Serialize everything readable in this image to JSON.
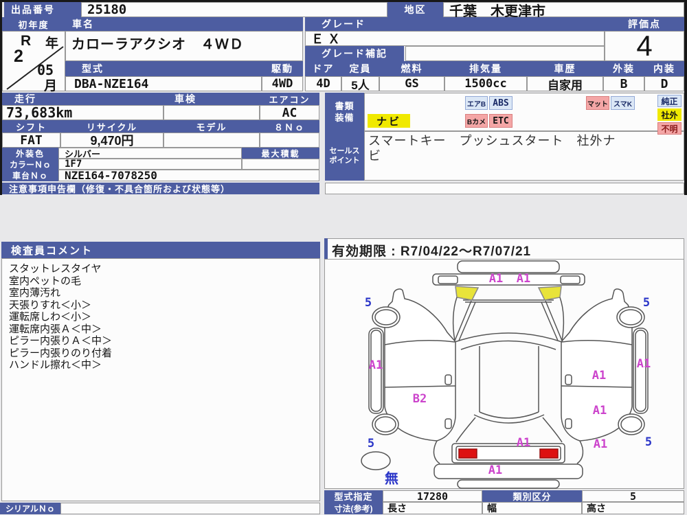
{
  "header": {
    "lot_label": "出品番号",
    "lot_value": "25180",
    "district_label": "地区",
    "district_value": "千葉　木更津市",
    "first_year_label": "初年度",
    "first_year_era": "R",
    "first_year_era_suffix": "年",
    "first_year_value": "2",
    "first_year_month": "05",
    "first_year_month_suffix": "月",
    "car_name_label": "車名",
    "car_name_value": "カローラアクシオ　４ＷＤ",
    "grade_label": "グレード",
    "grade_value": "ＥＸ",
    "grade_note_label": "グレード補記",
    "grade_note_value": "",
    "score_label": "評価点",
    "score_value": "4"
  },
  "specs": {
    "model_label": "型式",
    "model_value": "DBA-NZE164",
    "drive_label": "駆動",
    "drive_value": "4WD",
    "door_label": "ドア",
    "door_value": "4D",
    "capacity_label": "定員",
    "capacity_value": "5人",
    "fuel_label": "燃料",
    "fuel_value": "GS",
    "displacement_label": "排気量",
    "displacement_value": "1500cc",
    "history_label": "車歴",
    "history_value": "自家用",
    "exterior_label": "外装",
    "exterior_value": "B",
    "interior_label": "内装",
    "interior_value": "D"
  },
  "details": {
    "mileage_label": "走行",
    "mileage_value": "73,683km",
    "inspection_label": "車検",
    "inspection_value": "",
    "aircon_label": "エアコン",
    "aircon_value": "AC",
    "shift_label": "シフト",
    "shift_value": "FAT",
    "recycle_label": "リサイクル",
    "recycle_value": "9,470円",
    "model2_label": "モデル",
    "model2_value": "",
    "eight_no_label": "８Ｎｏ",
    "eight_no_value": "",
    "color_label": "外装色",
    "color_value": "シルバー",
    "max_load_label": "最大積載",
    "max_load_value": "",
    "color_no_label": "カラーＮｏ",
    "color_no_value": "1F7",
    "chassis_label": "車台Ｎｏ",
    "chassis_value": "NZE164-7078250",
    "notes_label": "注意事項申告欄（修復・不具合箇所および状態等）"
  },
  "equipment": {
    "docs_label_line1": "書類",
    "docs_label_line2": "装備",
    "navi": "ナビ",
    "airbag": "エアB",
    "abs": "ABS",
    "backcam": "Bカメ",
    "etc": "ETC",
    "mat": "マット",
    "smartkey": "スマK",
    "genuine": "純正",
    "aftermarket": "社外",
    "unknown": "不明"
  },
  "sales": {
    "label_line1": "セールス",
    "label_line2": "ポイント",
    "text": "スマートキー　プッシュスタート　社外ナビ"
  },
  "inspector": {
    "label": "検査員コメント",
    "comments": [
      "スタットレスタイヤ",
      "室内ペットの毛",
      "室内薄汚れ",
      "天張りすれ＜小＞",
      "運転席しわ＜小＞",
      "運転席内張Ａ＜中＞",
      "ピラー内張りＡ＜中＞",
      "ピラー内張りのり付着",
      "ハンドル擦れ＜中＞"
    ]
  },
  "validity": {
    "text": "有効期限 : R7/04/22～R7/07/21"
  },
  "diagram": {
    "labels": [
      {
        "text": "A1"
      },
      {
        "text": "A1"
      },
      {
        "text": "5"
      },
      {
        "text": "5"
      },
      {
        "text": "A1"
      },
      {
        "text": "A1"
      },
      {
        "text": "A1"
      },
      {
        "text": "B2"
      },
      {
        "text": "A1"
      },
      {
        "text": "A1"
      },
      {
        "text": "A1"
      },
      {
        "text": "5"
      },
      {
        "text": "5"
      },
      {
        "text": "A1"
      },
      {
        "text": "無"
      }
    ]
  },
  "footer": {
    "model_desig_label": "型式指定",
    "model_desig_value": "17280",
    "class_label": "類別区分",
    "class_value": "5",
    "dims_label": "寸法(参考)",
    "length_label": "長さ",
    "length_value": "",
    "width_label": "幅",
    "width_value": "",
    "height_label": "高さ",
    "height_value": "",
    "serial_label": "シリアルＮｏ",
    "serial_value": ""
  },
  "colors": {
    "header_blue": "#4d5da1",
    "badge_blue_bg": "#dbe7f6",
    "badge_pink_bg": "#f4a6a6",
    "badge_yellow": "#f0e900",
    "highlight_yellow": "#e8e33a",
    "taillight_red": "#dd1111",
    "label_magenta": "#cc44cc",
    "label_blue": "#2a35c8"
  }
}
